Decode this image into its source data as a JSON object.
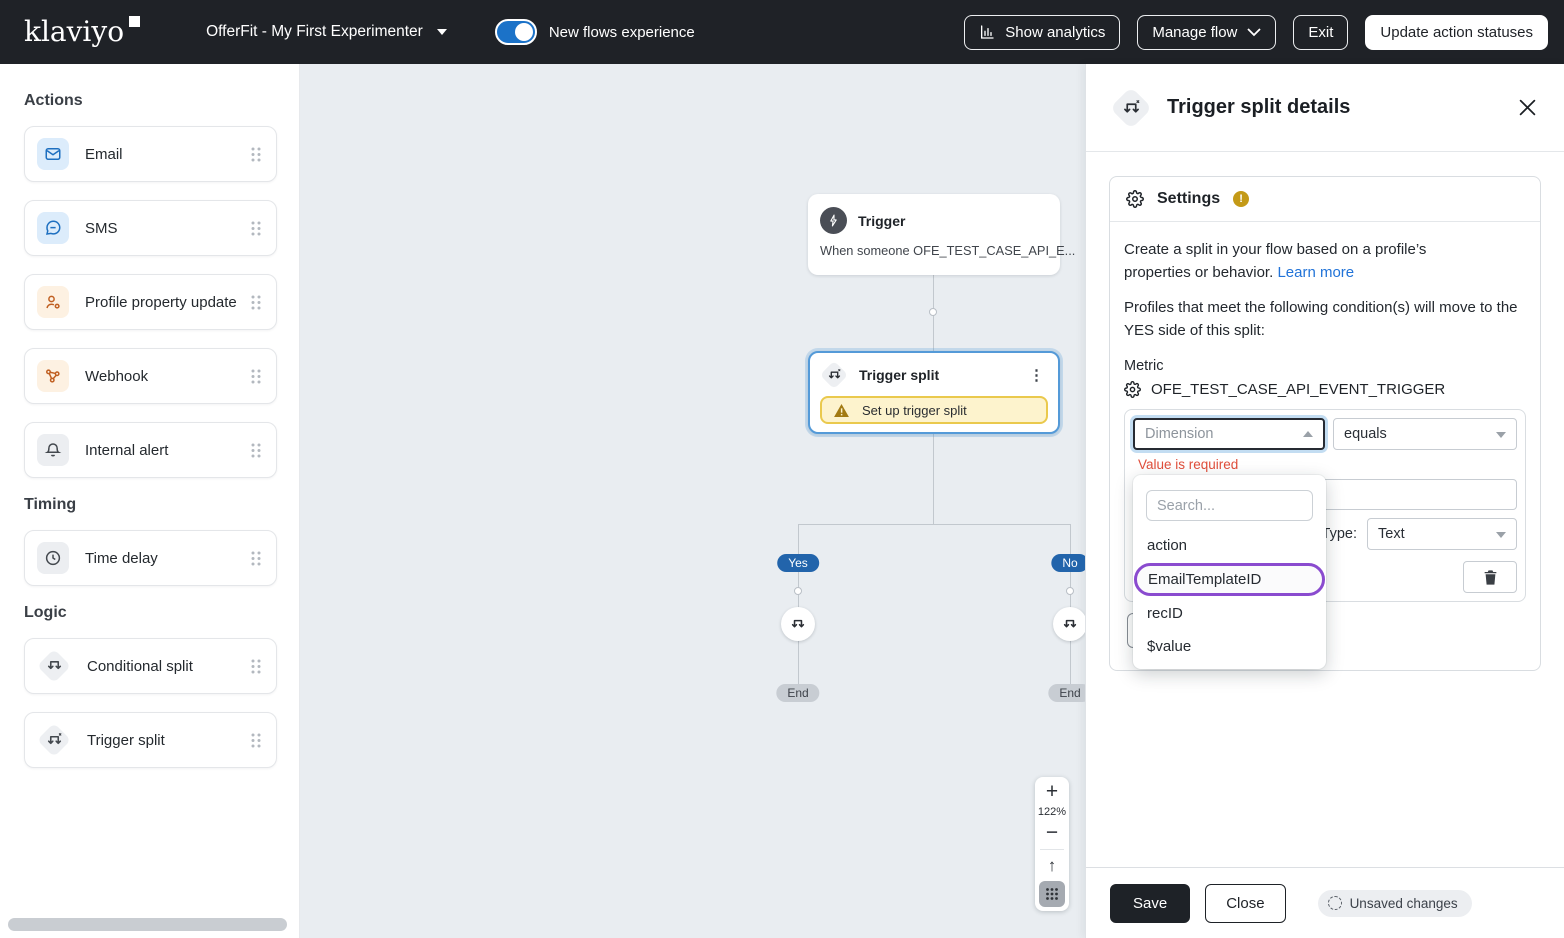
{
  "navbar": {
    "logo": "klaviyo",
    "flow_name": "OfferFit - My First Experimenter",
    "toggle_label": "New flows experience",
    "buttons": {
      "show_analytics": "Show analytics",
      "manage_flow": "Manage flow",
      "exit": "Exit",
      "update_action_statuses": "Update action statuses"
    }
  },
  "sidebar": {
    "sections": [
      {
        "title": "Actions",
        "items": [
          {
            "label": "Email",
            "icon": "email-icon"
          },
          {
            "label": "SMS",
            "icon": "sms-icon"
          },
          {
            "label": "Profile property update",
            "icon": "profile-icon"
          },
          {
            "label": "Webhook",
            "icon": "webhook-icon"
          },
          {
            "label": "Internal alert",
            "icon": "bell-icon"
          }
        ]
      },
      {
        "title": "Timing",
        "items": [
          {
            "label": "Time delay",
            "icon": "clock-icon"
          }
        ]
      },
      {
        "title": "Logic",
        "items": [
          {
            "label": "Conditional split",
            "icon": "conditional-split-icon"
          },
          {
            "label": "Trigger split",
            "icon": "trigger-split-icon"
          }
        ]
      }
    ]
  },
  "canvas": {
    "trigger_node": {
      "title": "Trigger",
      "description": "When someone OFE_TEST_CASE_API_E..."
    },
    "split_node": {
      "title": "Trigger split",
      "warning": "Set up trigger split"
    },
    "branch_labels": {
      "yes": "Yes",
      "no": "No",
      "end_left": "End",
      "end_right": "End"
    },
    "zoom_controls": {
      "zoom_in": "+",
      "zoom_level": "122%",
      "zoom_out": "−",
      "recenter": "↑"
    }
  },
  "panel": {
    "title": "Trigger split details",
    "settings": {
      "heading": "Settings",
      "warning_mark": "!",
      "description": "Create a split in your flow based on a profile’s properties or behavior.",
      "learn_more": "Learn more",
      "condition_text": "Profiles that meet the following condition(s) will move to the YES side of this split:",
      "metric_label": "Metric",
      "metric_value": "OFE_TEST_CASE_API_EVENT_TRIGGER",
      "dimension_placeholder": "Dimension",
      "operator": "equals",
      "validation_error": "Value is required",
      "condition_value": "",
      "type_label": "Type:",
      "type_value": "Text"
    },
    "dimension_dropdown": {
      "search_placeholder": "Search...",
      "options": [
        "action",
        "EmailTemplateID",
        "recID",
        "$value"
      ],
      "highlighted_option": "EmailTemplateID"
    },
    "footer": {
      "save": "Save",
      "close": "Close",
      "status": "Unsaved changes"
    }
  },
  "colors": {
    "navbar_bg": "#1f2227",
    "accent_blue": "#1b72c8",
    "selection_blue": "#549ad8",
    "branch_blue": "#2264ab",
    "highlight_purple": "#8a4bcf",
    "warning_chip_bg": "#fdf3cd",
    "warning_chip_border": "#eac94d",
    "error_red": "#e04e3b",
    "canvas_bg": "#e9edf1"
  }
}
